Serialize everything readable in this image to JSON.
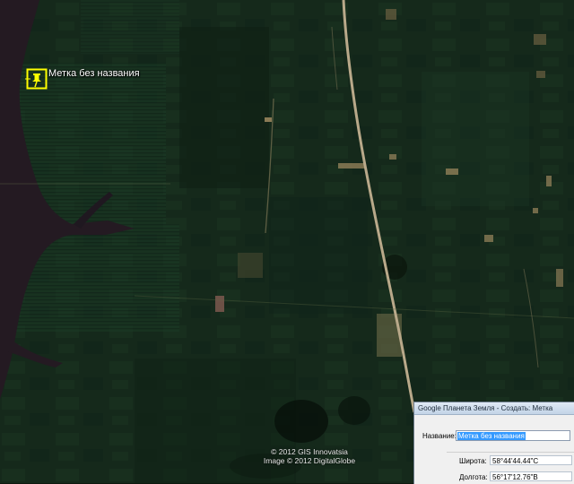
{
  "map": {
    "placemark_label": "Метка без названия",
    "copyright_line1": "© 2012 GIS Innovatsia",
    "copyright_line2": "Image © 2012 DigitalGlobe",
    "colors": {
      "forest": "#13281a",
      "river": "#241a22",
      "road": "#b9a98a",
      "placemark": "#ffff00"
    }
  },
  "dialog": {
    "title": "Google Планета Земля - Создать: Метка",
    "name_label": "Название:",
    "name_value": "Метка без названия",
    "latitude_label": "Широта:",
    "latitude_value": "58°44'44.44\"С",
    "longitude_label": "Долгота:",
    "longitude_value": "56°17'12.76\"В"
  }
}
